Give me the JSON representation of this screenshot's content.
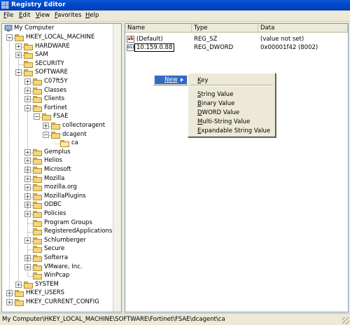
{
  "window": {
    "title": "Registry Editor",
    "icon": "registry-icon"
  },
  "menu": [
    {
      "label": "File",
      "key": "F",
      "rest": "ile"
    },
    {
      "label": "Edit",
      "key": "E",
      "rest": "dit"
    },
    {
      "label": "View",
      "key": "V",
      "rest": "iew"
    },
    {
      "label": "Favorites",
      "key": "F",
      "rest": "avorites"
    },
    {
      "label": "Help",
      "key": "H",
      "rest": "elp"
    }
  ],
  "tree": {
    "root": "My Computer",
    "nodes": [
      {
        "label": "HKEY_LOCAL_MACHINE",
        "level": 1,
        "expander": "-"
      },
      {
        "label": "HARDWARE",
        "level": 2,
        "expander": "+"
      },
      {
        "label": "SAM",
        "level": 2,
        "expander": "+"
      },
      {
        "label": "SECURITY",
        "level": 2,
        "expander": ""
      },
      {
        "label": "SOFTWARE",
        "level": 2,
        "expander": "-"
      },
      {
        "label": "C07ft5Y",
        "level": 3,
        "expander": "+"
      },
      {
        "label": "Classes",
        "level": 3,
        "expander": "+"
      },
      {
        "label": "Clients",
        "level": 3,
        "expander": "+"
      },
      {
        "label": "Fortinet",
        "level": 3,
        "expander": "-"
      },
      {
        "label": "FSAE",
        "level": 4,
        "expander": "-"
      },
      {
        "label": "collectoragent",
        "level": 5,
        "expander": "+"
      },
      {
        "label": "dcagent",
        "level": 5,
        "expander": "-"
      },
      {
        "label": "ca",
        "level": 6,
        "expander": "",
        "open": true
      },
      {
        "label": "Gemplus",
        "level": 3,
        "expander": "+"
      },
      {
        "label": "Helios",
        "level": 3,
        "expander": "+"
      },
      {
        "label": "Microsoft",
        "level": 3,
        "expander": "+"
      },
      {
        "label": "Mozilla",
        "level": 3,
        "expander": "+"
      },
      {
        "label": "mozilla.org",
        "level": 3,
        "expander": "+"
      },
      {
        "label": "MozillaPlugins",
        "level": 3,
        "expander": "+"
      },
      {
        "label": "ODBC",
        "level": 3,
        "expander": "+"
      },
      {
        "label": "Policies",
        "level": 3,
        "expander": "+"
      },
      {
        "label": "Program Groups",
        "level": 3,
        "expander": ""
      },
      {
        "label": "RegisteredApplications",
        "level": 3,
        "expander": ""
      },
      {
        "label": "Schlumberger",
        "level": 3,
        "expander": "+"
      },
      {
        "label": "Secure",
        "level": 3,
        "expander": ""
      },
      {
        "label": "Softerra",
        "level": 3,
        "expander": "+"
      },
      {
        "label": "VMware, Inc.",
        "level": 3,
        "expander": "+"
      },
      {
        "label": "WinPcap",
        "level": 3,
        "expander": ""
      },
      {
        "label": "SYSTEM",
        "level": 2,
        "expander": "+"
      },
      {
        "label": "HKEY_USERS",
        "level": 1,
        "expander": "+"
      },
      {
        "label": "HKEY_CURRENT_CONFIG",
        "level": 1,
        "expander": "+"
      }
    ]
  },
  "list": {
    "columns": [
      "Name",
      "Type",
      "Data"
    ],
    "rows": [
      {
        "icon": "string-value-icon",
        "glyph": "ab",
        "name": "(Default)",
        "type": "REG_SZ",
        "data": "(value not set)"
      },
      {
        "icon": "binary-value-icon",
        "glyph": "011",
        "name": "10.159.0.88",
        "type": "REG_DWORD",
        "data": "0x00001f42 (8002)",
        "renaming": true
      }
    ]
  },
  "context_menu": {
    "new_label": "New",
    "submenu": [
      {
        "label": "Key",
        "key": "K",
        "rest": "ey"
      },
      {
        "separator": true
      },
      {
        "label": "String Value",
        "key": "S",
        "rest": "tring Value"
      },
      {
        "label": "Binary Value",
        "key": "B",
        "rest": "inary Value"
      },
      {
        "label": "DWORD Value",
        "key": "D",
        "rest": "WORD Value"
      },
      {
        "label": "Multi-String Value",
        "key": "M",
        "rest": "ulti-String Value"
      },
      {
        "label": "Expandable String Value",
        "key": "E",
        "rest": "xpandable String Value"
      }
    ]
  },
  "status": {
    "path": "My Computer\\HKEY_LOCAL_MACHINE\\SOFTWARE\\Fortinet\\FSAE\\dcagent\\ca"
  }
}
